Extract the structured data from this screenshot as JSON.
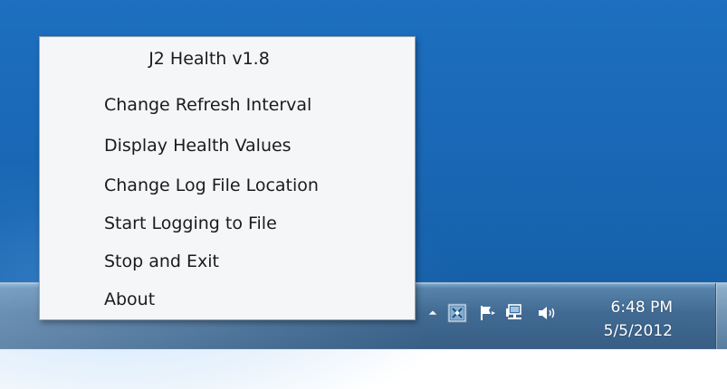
{
  "context_menu": {
    "title": "J2 Health v1.8",
    "items": [
      {
        "label": "Change Refresh Interval"
      },
      {
        "label": "Display Health Values"
      },
      {
        "label": "Change Log File Location"
      },
      {
        "label": "Start Logging to File"
      },
      {
        "label": "Stop and Exit"
      },
      {
        "label": "About"
      }
    ]
  },
  "taskbar": {
    "tray_icons": [
      {
        "icon": "show-hidden-icons-arrow-icon"
      },
      {
        "icon": "health-app-tray-icon"
      },
      {
        "icon": "action-center-flag-icon"
      },
      {
        "icon": "network-icon"
      },
      {
        "icon": "volume-icon"
      }
    ],
    "clock": {
      "time": "6:48 PM",
      "date": "5/5/2012"
    }
  },
  "colors": {
    "desktop_blue": "#1a69b8",
    "menu_background": "#f5f6f7",
    "menu_text": "#1b1b1b",
    "menu_border": "#9aa3ab",
    "tray_text": "#ffffff"
  }
}
